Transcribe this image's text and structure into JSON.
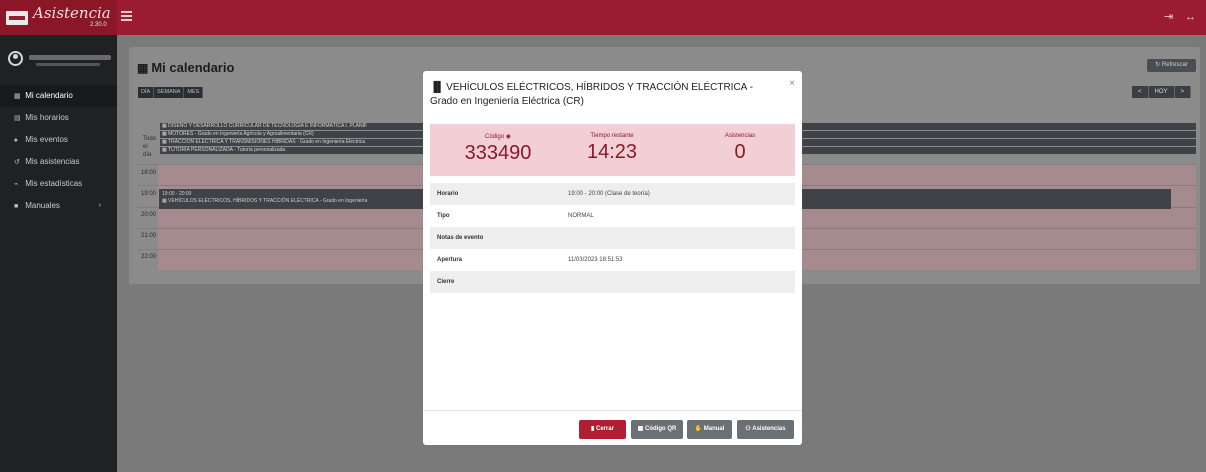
{
  "app": {
    "name": "Asistencia",
    "version": "2.30.0"
  },
  "header": {
    "menu_icon": "hamburger-icon",
    "logout_icon": "logout-icon",
    "fullscreen_icon": "fullscreen-icon"
  },
  "sidebar": {
    "items": [
      {
        "label": "Mi calendario",
        "icon": "calendar-icon"
      },
      {
        "label": "Mis horarios",
        "icon": "schedule-icon"
      },
      {
        "label": "Mis eventos",
        "icon": "bell-icon"
      },
      {
        "label": "Mis asistencias",
        "icon": "history-icon"
      },
      {
        "label": "Mis estadísticas",
        "icon": "chart-icon"
      },
      {
        "label": "Manuales",
        "icon": "book-icon"
      }
    ]
  },
  "calendar": {
    "title": "Mi calendario",
    "views": [
      "DÍA",
      "SEMANA",
      "MES"
    ],
    "refresh_label": "Refrescar",
    "prev_label": "<",
    "today_label": "HOY",
    "next_label": ">",
    "allday_label": "Todo el día",
    "allday_events": [
      "DISEÑO Y DESARROLLO CURRICULAR DE TECNOLOGÍA E INFORMÁTICA I. PLANIF",
      "MOTORES - Grado en Ingeniería Agrícola y Agroalimentaria (CR)",
      "TRACCIÓN ELÉCTRICA Y TRANSMISIONES HÍBRIDAS - Grado en Ingeniería Eléctrica",
      "TUTORÍA PERSONALIZADA - Tutoría personalizada"
    ],
    "times": [
      "18:00",
      "19:00",
      "20:00",
      "21:00",
      "22:00"
    ],
    "event": {
      "time": "19:00 - 20:00",
      "title": "VEHÍCULOS ELÉCTRICOS, HÍBRIDOS Y TRACCIÓN ELÉCTRICA - Grado en Ingeniería"
    }
  },
  "modal": {
    "title": "VEHÍCULOS ELÉCTRICOS, HÍBRIDOS Y TRACCIÓN ELÉCTRICA - Grado en Ingeniería Eléctrica (CR)",
    "close": "×",
    "stats": {
      "code_label": "Código",
      "code_value": "333490",
      "time_label": "Tiempo restante",
      "time_value": "14:23",
      "attend_label": "Asistencias",
      "attend_value": "0"
    },
    "rows": [
      {
        "label": "Horario",
        "value": "19:00 - 20:00 (Clase de teoría)"
      },
      {
        "label": "Tipo",
        "value": "NORMAL"
      },
      {
        "label": "Notas de evento",
        "value": ""
      },
      {
        "label": "Apertura",
        "value": "11/03/2023 18:51:53"
      },
      {
        "label": "Cierre",
        "value": ""
      }
    ],
    "buttons": {
      "close": "Cerrar",
      "qr": "Código QR",
      "manual": "Manual",
      "attendances": "Asistencias"
    }
  },
  "colors": {
    "brand": "#9b1b30",
    "sidebar": "#202124",
    "stats_bg": "#f2cfd4",
    "stats_text": "#8a1a2a"
  }
}
